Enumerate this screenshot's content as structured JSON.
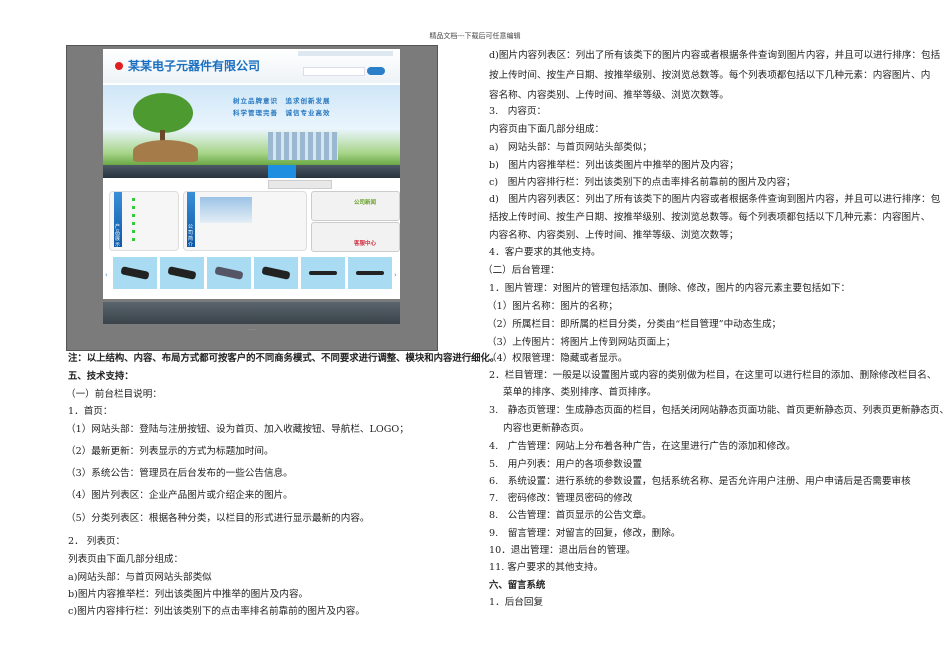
{
  "header": {
    "watermark": "精品文档---下载后可任意编辑"
  },
  "screenshot": {
    "company_name": "某某电子元器件有限公司",
    "slogan_line1": "树立品牌意识　追求创新发展",
    "slogan_line2": "科学管理完善　诚信专业高效",
    "product_label": "产品展示",
    "about_label": "公司简介",
    "news_label": "公司新闻",
    "service_label": "客服中心",
    "colors": {
      "brand": "#1a6fc0",
      "nav": "#27323c",
      "nav_active": "#1e8ee0"
    }
  },
  "left": {
    "note": "注：以上结构、内容、布局方式都可按客户的不同商务模式、不同要求进行调整、模块和内容进行细化。",
    "section5": "五、技术支持：",
    "sub1": "（一）前台栏目说明：",
    "home": "1．首页：",
    "home_items": [
      "（1）网站头部：登陆与注册按钮、设为首页、加入收藏按钮、导航栏、LOGO；",
      "（2）最新更新：列表显示的方式为标题加时间。",
      "（3）系统公告：管理员在后台发布的一些公告信息。",
      "（4）图片列表区：企业产品图片或介绍企来的图片。",
      "（5）分类列表区：根据各种分类，以栏目的形式进行显示最新的内容。"
    ],
    "list_page": "2．  列表页：",
    "list_intro": "列表页由下面几部分组成：",
    "list_items": [
      "a)网站头部：与首页网站头部类似",
      "b)图片内容推举栏：列出该类图片中推举的图片及内容。",
      "c)图片内容排行栏：列出该类别下的点击率排名前靠前的图片及内容。"
    ]
  },
  "right": {
    "lines": [
      "d)图片内容列表区：列出了所有该类下的图片内容或者根据条件查询到图片内容，并且可以进行排序：包括",
      "按上传时间、按生产日期、按推举级别、按浏览总数等。每个列表项都包括以下几种元素：内容图片、内",
      "容名称、内容类别、上传时间、推举等级、浏览次数等。",
      "3.　内容页：",
      "内容页由下面几部分组成：",
      "a)　网站头部：与首页网站头部类似；",
      "b)　图片内容推举栏：列出该类图片中推举的图片及内容；",
      "c)　图片内容排行栏：列出该类别下的点击率排名前靠前的图片及内容；",
      "d)　图片内容列表区：列出了所有该类下的图片内容或者根据条件查询到图片内容，并且可以进行排序：包",
      "括按上传时间、按生产日期、按推举级别、按浏览总数等。每个列表项都包括以下几种元素：内容图片、",
      "内容名称、内容类别、上传时间、推举等级、浏览次数等；",
      "4．客户要求的其他支持。",
      "（二）后台管理：",
      "1．图片管理：对图片的管理包括添加、删除、修改，图片的内容元素主要包括如下：",
      "（1）图片名称：图片的名称；",
      "（2）所属栏目：即所属的栏目分类，分类由“栏目管理”中动态生成；",
      "（3）上传图片：将图片上传到网站页面上；",
      "（4）权限管理：隐藏或者显示。",
      "2．栏目管理：一般是以设置图片或内容的类别做为栏目，在这里可以进行栏目的添加、删除修改栏目名、",
      "菜单的排序、类别排序、首页排序。",
      "3.　静态页管理：生成静态页面的栏目，包括关闭网站静态页面功能、首页更新静态页、列表页更新静态页、",
      "内容也更新静态页。",
      "4.　广告管理：网站上分布着各种广告，在这里进行广告的添加和修改。",
      "5.　用户列表：用户的各项参数设置",
      "6.　系统设置：进行系统的参数设置，包括系统名称、是否允许用户注册、用户申请后是否需要审核",
      "7.　密码修改：管理员密码的修改",
      "8.　公告管理：首页显示的公告文章。",
      "9.　留言管理：对留言的回复，修改，删除。",
      "10．退出管理：退出后台的管理。",
      "11. 客户要求的其他支持。",
      "六、留言系统",
      "1．后台回复"
    ]
  }
}
